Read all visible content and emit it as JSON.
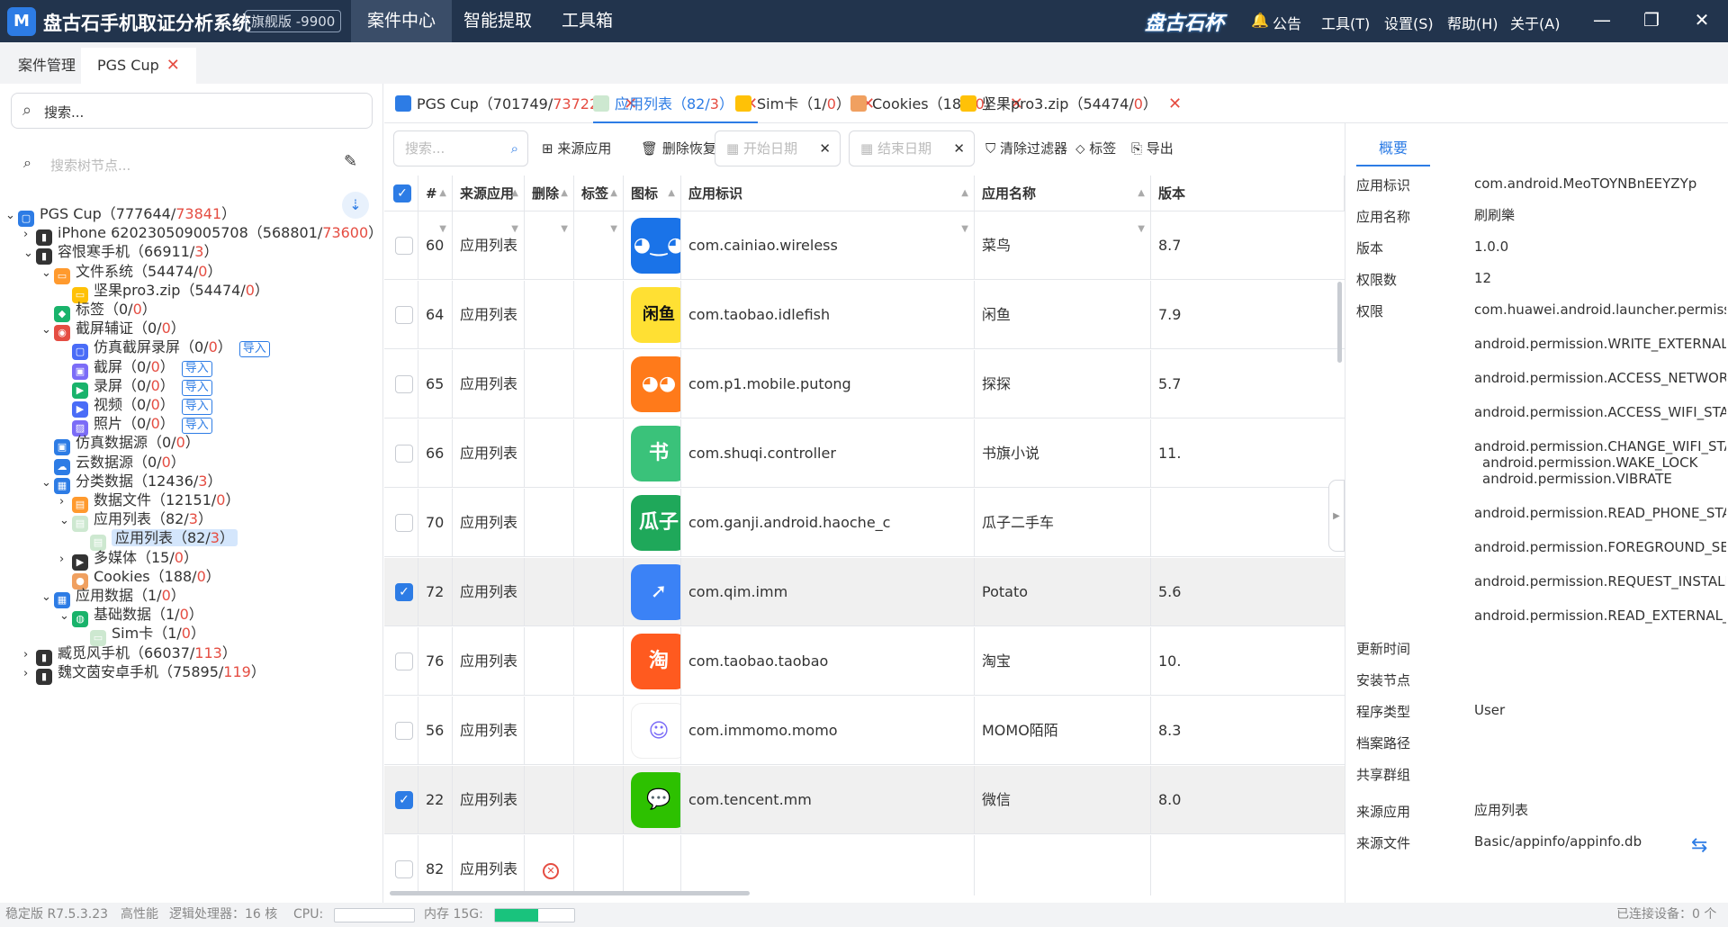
{
  "titlebar": {
    "logo": "M",
    "app_title": "盘古石手机取证分析系统",
    "edition": "旗舰版 -9900",
    "menus": [
      "案件中心",
      "智能提取",
      "工具箱"
    ],
    "brand": "盘古石杯",
    "right_menus": [
      "公告",
      "工具(T)",
      "设置(S)",
      "帮助(H)",
      "关于(A)"
    ]
  },
  "case_tabs": [
    {
      "label": "案件管理"
    },
    {
      "label": "PGS Cup"
    }
  ],
  "left": {
    "search_placeholder": "搜索...",
    "tree_search_placeholder": "搜索树节点...",
    "tree": [
      {
        "label": "PGS Cup（777644/",
        "red": "73841",
        "tail": "）"
      },
      {
        "label": "iPhone 620230509005708（568801/",
        "red": "73600",
        "tail": "）"
      },
      {
        "label": "容恨寒手机（66911/",
        "red": "3",
        "tail": "）"
      },
      {
        "label": "文件系统（54474/",
        "red": "0",
        "tail": "）"
      },
      {
        "label": "坚果pro3.zip（54474/",
        "red": "0",
        "tail": "）"
      },
      {
        "label": "标签（0/",
        "red": "0",
        "tail": "）"
      },
      {
        "label": "截屏辅证（0/",
        "red": "0",
        "tail": "）"
      },
      {
        "label": "仿真截屏录屏（0/",
        "red": "0",
        "tail": "）",
        "import": "导入"
      },
      {
        "label": "截屏（0/",
        "red": "0",
        "tail": "）",
        "import": "导入"
      },
      {
        "label": "录屏（0/",
        "red": "0",
        "tail": "）",
        "import": "导入"
      },
      {
        "label": "视频（0/",
        "red": "0",
        "tail": "）",
        "import": "导入"
      },
      {
        "label": "照片（0/",
        "red": "0",
        "tail": "）",
        "import": "导入"
      },
      {
        "label": "仿真数据源（0/",
        "red": "0",
        "tail": "）"
      },
      {
        "label": "云数据源（0/",
        "red": "0",
        "tail": "）"
      },
      {
        "label": "分类数据（12436/",
        "red": "3",
        "tail": "）"
      },
      {
        "label": "数据文件（12151/",
        "red": "0",
        "tail": "）"
      },
      {
        "label": "应用列表（82/",
        "red": "3",
        "tail": "）"
      },
      {
        "label": "应用列表（82/",
        "red": "3",
        "tail": "）"
      },
      {
        "label": "多媒体（15/",
        "red": "0",
        "tail": "）"
      },
      {
        "label": "Cookies（188/",
        "red": "0",
        "tail": "）"
      },
      {
        "label": "应用数据（1/",
        "red": "0",
        "tail": "）"
      },
      {
        "label": "基础数据（1/",
        "red": "0",
        "tail": "）"
      },
      {
        "label": "Sim卡（1/",
        "red": "0",
        "tail": "）"
      },
      {
        "label": "臧觅风手机（66037/",
        "red": "113",
        "tail": "）"
      },
      {
        "label": "魏文茵安卓手机（75895/",
        "red": "119",
        "tail": "）"
      }
    ]
  },
  "content_tabs": [
    {
      "label": "PGS Cup（701749/",
      "red": "73722",
      "tail": "）"
    },
    {
      "label": "应用列表（82/",
      "red": "3",
      "tail": "）"
    },
    {
      "label": "Sim卡（1/",
      "red": "0",
      "tail": "）"
    },
    {
      "label": "Cookies（188/",
      "red": "0",
      "tail": "）"
    },
    {
      "label": "坚果pro3.zip（54474/",
      "red": "0",
      "tail": "）"
    }
  ],
  "toolbar": {
    "search_placeholder": "搜索...",
    "source_app": "来源应用",
    "delete_restore": "删除恢复",
    "start_date": "开始日期",
    "end_date": "结束日期",
    "clear_filter": "清除过滤器",
    "tag": "标签",
    "export": "导出"
  },
  "table": {
    "headers": [
      "#",
      "来源应用",
      "删除",
      "标签",
      "图标",
      "应用标识",
      "应用名称",
      "版本"
    ],
    "rows": [
      {
        "num": "60",
        "source": "应用列表",
        "id": "com.cainiao.wireless",
        "name": "菜鸟",
        "version": "8.7",
        "checked": false,
        "icon_color": "#1a73e8",
        "icon_text": "◕‿◕"
      },
      {
        "num": "64",
        "source": "应用列表",
        "id": "com.taobao.idlefish",
        "name": "闲鱼",
        "version": "7.9",
        "checked": false,
        "icon_color": "#ffe033",
        "icon_text": "闲鱼"
      },
      {
        "num": "65",
        "source": "应用列表",
        "id": "com.p1.mobile.putong",
        "name": "探探",
        "version": "5.7",
        "checked": false,
        "icon_color": "#ff7a1a",
        "icon_text": "◕◕"
      },
      {
        "num": "66",
        "source": "应用列表",
        "id": "com.shuqi.controller",
        "name": "书旗小说",
        "version": "11.",
        "checked": false,
        "icon_color": "#3ac27a",
        "icon_text": "书"
      },
      {
        "num": "70",
        "source": "应用列表",
        "id": "com.ganji.android.haoche_c",
        "name": "瓜子二手车",
        "version": "",
        "checked": false,
        "icon_color": "#1fa85a",
        "icon_text": "瓜子"
      },
      {
        "num": "72",
        "source": "应用列表",
        "id": "com.qim.imm",
        "name": "Potato",
        "version": "5.6",
        "checked": true,
        "icon_color": "#3b82f6",
        "icon_text": "➚"
      },
      {
        "num": "76",
        "source": "应用列表",
        "id": "com.taobao.taobao",
        "name": "淘宝",
        "version": "10.",
        "checked": false,
        "icon_color": "#ff5a1f",
        "icon_text": "淘"
      },
      {
        "num": "56",
        "source": "应用列表",
        "id": "com.immomo.momo",
        "name": "MOMO陌陌",
        "version": "8.3",
        "checked": false,
        "icon_color": "#ffffff",
        "icon_text": "☺"
      },
      {
        "num": "22",
        "source": "应用列表",
        "id": "com.tencent.mm",
        "name": "微信",
        "version": "8.0",
        "checked": true,
        "icon_color": "#2dc100",
        "icon_text": "💬"
      },
      {
        "num": "82",
        "source": "应用列表",
        "id": "",
        "name": "",
        "version": "",
        "checked": false,
        "deleted": true
      }
    ]
  },
  "detail": {
    "tab": "概要",
    "fields": [
      {
        "label": "应用标识",
        "value": "com.android.MeoTOYNBnEEYZYp"
      },
      {
        "label": "应用名称",
        "value": "刷刷樂"
      },
      {
        "label": "版本",
        "value": "1.0.0"
      },
      {
        "label": "权限数",
        "value": "12"
      },
      {
        "label": "权限",
        "value": "com.huawei.android.launcher.permiss"
      }
    ],
    "permissions": [
      "android.permission.WRITE_EXTERNAL",
      "android.permission.ACCESS_NETWOR",
      "android.permission.ACCESS_WIFI_STA",
      "android.permission.CHANGE_WIFI_STA",
      "android.permission.WAKE_LOCK",
      "android.permission.VIBRATE",
      "android.permission.READ_PHONE_STA",
      "android.permission.FOREGROUND_SE",
      "android.permission.REQUEST_INSTALL",
      "android.permission.READ_EXTERNAL_"
    ],
    "lower_fields": [
      {
        "label": "更新时间",
        "value": ""
      },
      {
        "label": "安装节点",
        "value": ""
      },
      {
        "label": "程序类型",
        "value": "User"
      },
      {
        "label": "档案路径",
        "value": ""
      },
      {
        "label": "共享群组",
        "value": ""
      },
      {
        "label": "来源应用",
        "value": "应用列表"
      },
      {
        "label": "来源文件",
        "value": "Basic/appinfo/appinfo.db"
      }
    ]
  },
  "status": {
    "version": "稳定版  R7.5.3.23",
    "perf": "高性能",
    "cores": "逻辑处理器：16 核",
    "cpu": "CPU:",
    "mem": "内存 15G:",
    "mem_level": 0.55,
    "connected": "已连接设备：0 个"
  },
  "colors": {
    "accent": "#2d7ce5",
    "titlebar": "#22344d",
    "red": "#e54d42"
  }
}
